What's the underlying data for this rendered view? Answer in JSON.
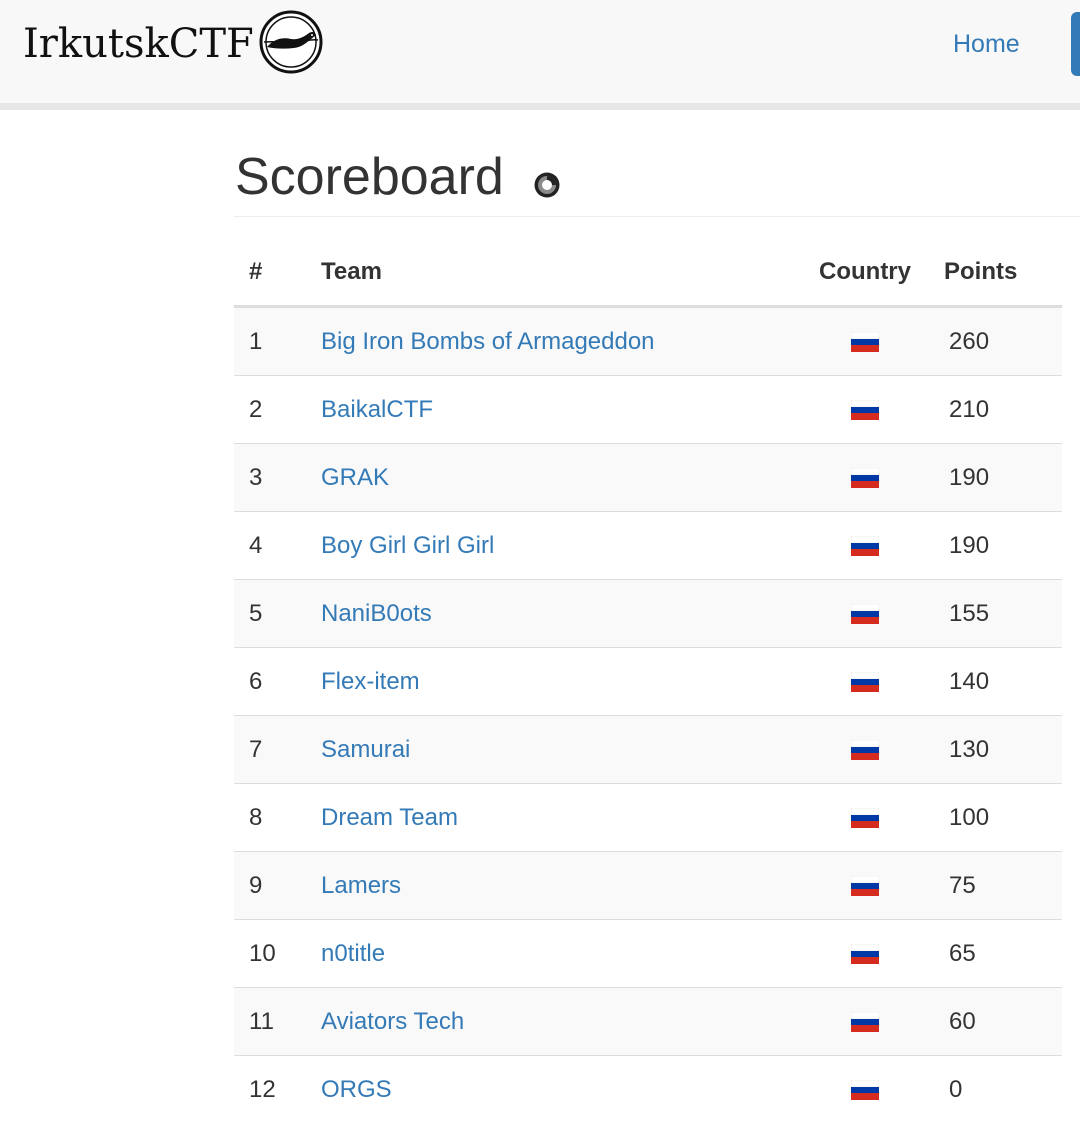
{
  "navbar": {
    "brand": "IrkutskCTF",
    "home_label": "Home"
  },
  "page": {
    "title": "Scoreboard"
  },
  "table": {
    "headers": {
      "rank": "#",
      "team": "Team",
      "country": "Country",
      "points": "Points"
    },
    "rows": [
      {
        "rank": "1",
        "team": "Big Iron Bombs of Armageddon",
        "country": "ru-flag-icon",
        "points": "260"
      },
      {
        "rank": "2",
        "team": "BaikalCTF",
        "country": "ru-flag-icon",
        "points": "210"
      },
      {
        "rank": "3",
        "team": "GRAK",
        "country": "ru-flag-icon",
        "points": "190"
      },
      {
        "rank": "4",
        "team": "Boy Girl Girl Girl",
        "country": "ru-flag-icon",
        "points": "190"
      },
      {
        "rank": "5",
        "team": "NaniB0ots",
        "country": "ru-flag-icon",
        "points": "155"
      },
      {
        "rank": "6",
        "team": "Flex-item",
        "country": "ru-flag-icon",
        "points": "140"
      },
      {
        "rank": "7",
        "team": "Samurai",
        "country": "ru-flag-icon",
        "points": "130"
      },
      {
        "rank": "8",
        "team": "Dream Team",
        "country": "ru-flag-icon",
        "points": "100"
      },
      {
        "rank": "9",
        "team": "Lamers",
        "country": "ru-flag-icon",
        "points": "75"
      },
      {
        "rank": "10",
        "team": "n0title",
        "country": "ru-flag-icon",
        "points": "65"
      },
      {
        "rank": "11",
        "team": "Aviators Tech",
        "country": "ru-flag-icon",
        "points": "60"
      },
      {
        "rank": "12",
        "team": "ORGS",
        "country": "ru-flag-icon",
        "points": "0"
      }
    ]
  },
  "colors": {
    "link": "#337ab7",
    "navbar_bg": "#f8f8f8",
    "stripe": "#f9f9f9",
    "flag_white": "#ffffff",
    "flag_blue": "#0039a6",
    "flag_red": "#d52b1e"
  }
}
